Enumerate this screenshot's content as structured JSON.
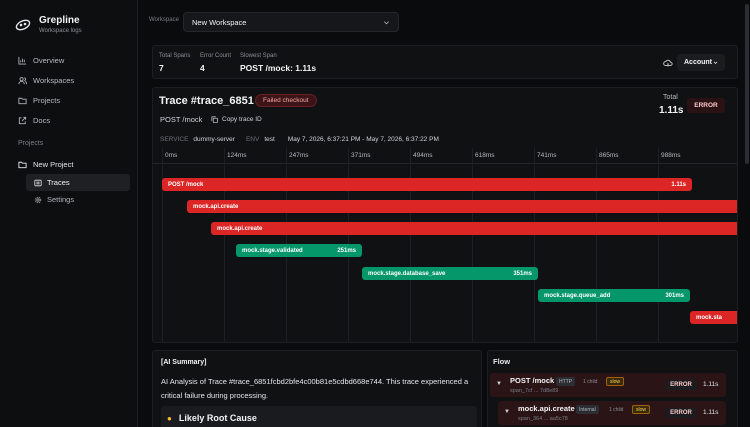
{
  "app": {
    "name": "Grepline",
    "subtitle": "Workspace logs"
  },
  "nav": [
    {
      "label": "Overview",
      "icon": "chart-icon"
    },
    {
      "label": "Workspaces",
      "icon": "users-icon"
    },
    {
      "label": "Projects",
      "icon": "folder-icon"
    },
    {
      "label": "Docs",
      "icon": "external-link-icon"
    }
  ],
  "projects": {
    "section_label": "Projects",
    "project_name": "New Project",
    "sub_items": [
      {
        "label": "Traces",
        "active": true
      },
      {
        "label": "Settings",
        "active": false
      }
    ]
  },
  "workspace": {
    "label": "Workspace",
    "value": "New Workspace"
  },
  "stats": {
    "total_spans_label": "Total Spans",
    "total_spans": "7",
    "error_count_label": "Error Count",
    "error_count": "4",
    "slowest_label": "Slowest Span",
    "slowest": "POST /mock: 1.11s",
    "account_label": "Account"
  },
  "trace": {
    "title": "Trace #trace_6851",
    "status_badge": "Failed checkout",
    "total_label": "Total",
    "total_value": "1.11s",
    "error_badge": "ERROR",
    "method": "POST /mock",
    "copy_label": "Copy trace ID",
    "service_key": "SERVICE",
    "service": "dummy-server",
    "env_key": "ENV",
    "env": "test",
    "time_range": "May 7, 2026, 6:37:21 PM - May 7, 2026, 6:37:22 PM"
  },
  "timeline": {
    "ticks": [
      "0ms",
      "124ms",
      "247ms",
      "371ms",
      "494ms",
      "618ms",
      "741ms",
      "865ms",
      "988ms"
    ],
    "spans": [
      {
        "name": "POST /mock",
        "duration": "1.11s",
        "status": "error",
        "color": "#dc2626"
      },
      {
        "name": "mock.api.create",
        "duration": "",
        "status": "error",
        "color": "#dc2626"
      },
      {
        "name": "mock.api.create",
        "duration": "",
        "status": "error",
        "color": "#dc2626"
      },
      {
        "name": "mock.stage.validated",
        "duration": "251ms",
        "status": "ok",
        "color": "#059669"
      },
      {
        "name": "mock.stage.database_save",
        "duration": "351ms",
        "status": "ok",
        "color": "#059669"
      },
      {
        "name": "mock.stage.queue_add",
        "duration": "301ms",
        "status": "ok",
        "color": "#059669"
      },
      {
        "name": "mock.sta",
        "duration": "",
        "status": "error",
        "color": "#dc2626"
      }
    ]
  },
  "ai_summary": {
    "title": "[AI Summary]",
    "body": "AI Analysis of Trace #trace_6851fcbd2bfe4c00b81e5cdbd668e744. This trace experienced a critical failure during processing.",
    "cause_title": "Likely Root Cause"
  },
  "flow": {
    "title": "Flow",
    "nodes": [
      {
        "name": "POST /mock",
        "type": "HTTP",
        "children": "1 child",
        "slow": "slow",
        "span_id": "span_7cf ... 7d8e89",
        "status": "ERROR",
        "duration": "1.11s"
      },
      {
        "name": "mock.api.create",
        "type": "Internal",
        "children": "1 child",
        "slow": "slow",
        "span_id": "span_364 ... aa5c78",
        "status": "ERROR",
        "duration": "1.11s"
      }
    ]
  }
}
